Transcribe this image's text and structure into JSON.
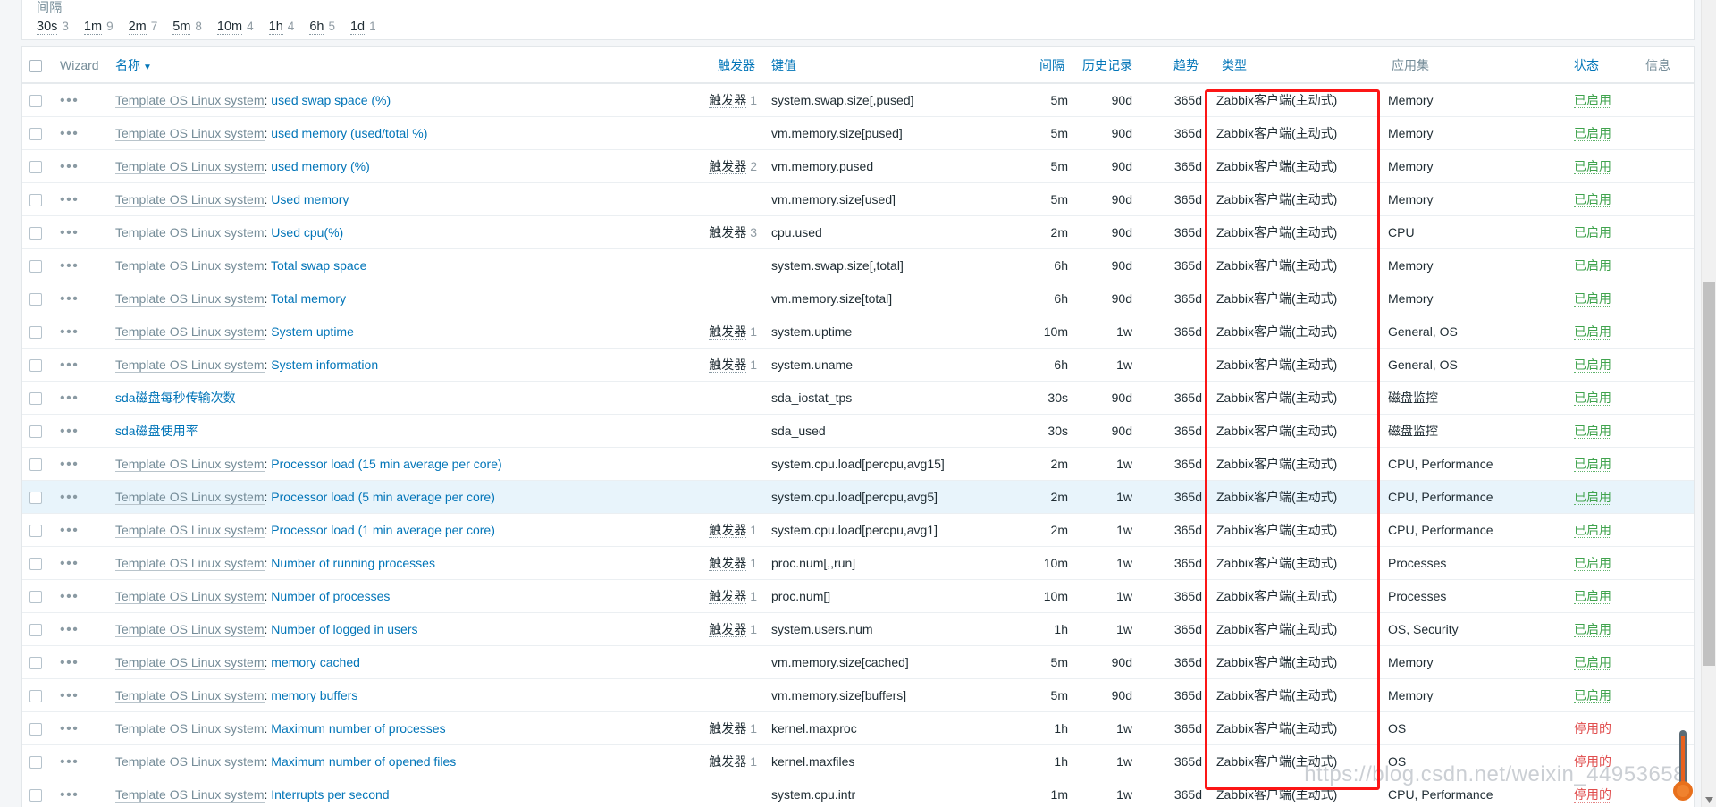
{
  "filter": {
    "label": "间隔",
    "intervals": [
      {
        "value": "30s",
        "count": "3"
      },
      {
        "value": "1m",
        "count": "9"
      },
      {
        "value": "2m",
        "count": "7"
      },
      {
        "value": "5m",
        "count": "8"
      },
      {
        "value": "10m",
        "count": "4"
      },
      {
        "value": "1h",
        "count": "4"
      },
      {
        "value": "6h",
        "count": "5"
      },
      {
        "value": "1d",
        "count": "1"
      }
    ]
  },
  "table": {
    "headers": {
      "wizard": "Wizard",
      "name": "名称",
      "sort_arrow": "▼",
      "triggers": "触发器",
      "key": "键值",
      "interval": "间隔",
      "history": "历史记录",
      "trends": "趋势",
      "type": "类型",
      "applications": "应用集",
      "status": "状态",
      "info": "信息"
    },
    "template_prefix": "Template OS Linux system",
    "triggers_label": "触发器",
    "status_enabled": "已启用",
    "status_disabled": "停用的",
    "type_agent_active": "Zabbix客户端(主动式)",
    "rows": [
      {
        "prefix": "Template OS Linux system",
        "name": "used swap space (%)",
        "triggers": "1",
        "key": "system.swap.size[,pused]",
        "interval": "5m",
        "history": "90d",
        "trends": "365d",
        "type": "Zabbix客户端(主动式)",
        "app": "Memory",
        "status": "已启用",
        "enabled": true,
        "hovered": false
      },
      {
        "prefix": "Template OS Linux system",
        "name": "used memory (used/total %)",
        "triggers": "",
        "key": "vm.memory.size[pused]",
        "interval": "5m",
        "history": "90d",
        "trends": "365d",
        "type": "Zabbix客户端(主动式)",
        "app": "Memory",
        "status": "已启用",
        "enabled": true,
        "hovered": false
      },
      {
        "prefix": "Template OS Linux system",
        "name": "used memory (%)",
        "triggers": "2",
        "key": "vm.memory.pused",
        "interval": "5m",
        "history": "90d",
        "trends": "365d",
        "type": "Zabbix客户端(主动式)",
        "app": "Memory",
        "status": "已启用",
        "enabled": true,
        "hovered": false
      },
      {
        "prefix": "Template OS Linux system",
        "name": "Used memory",
        "triggers": "",
        "key": "vm.memory.size[used]",
        "interval": "5m",
        "history": "90d",
        "trends": "365d",
        "type": "Zabbix客户端(主动式)",
        "app": "Memory",
        "status": "已启用",
        "enabled": true,
        "hovered": false
      },
      {
        "prefix": "Template OS Linux system",
        "name": "Used cpu(%)",
        "triggers": "3",
        "key": "cpu.used",
        "interval": "2m",
        "history": "90d",
        "trends": "365d",
        "type": "Zabbix客户端(主动式)",
        "app": "CPU",
        "status": "已启用",
        "enabled": true,
        "hovered": false
      },
      {
        "prefix": "Template OS Linux system",
        "name": "Total swap space",
        "triggers": "",
        "key": "system.swap.size[,total]",
        "interval": "6h",
        "history": "90d",
        "trends": "365d",
        "type": "Zabbix客户端(主动式)",
        "app": "Memory",
        "status": "已启用",
        "enabled": true,
        "hovered": false
      },
      {
        "prefix": "Template OS Linux system",
        "name": "Total memory",
        "triggers": "",
        "key": "vm.memory.size[total]",
        "interval": "6h",
        "history": "90d",
        "trends": "365d",
        "type": "Zabbix客户端(主动式)",
        "app": "Memory",
        "status": "已启用",
        "enabled": true,
        "hovered": false
      },
      {
        "prefix": "Template OS Linux system",
        "name": "System uptime",
        "triggers": "1",
        "key": "system.uptime",
        "interval": "10m",
        "history": "1w",
        "trends": "365d",
        "type": "Zabbix客户端(主动式)",
        "app": "General, OS",
        "status": "已启用",
        "enabled": true,
        "hovered": false
      },
      {
        "prefix": "Template OS Linux system",
        "name": "System information",
        "triggers": "1",
        "key": "system.uname",
        "interval": "6h",
        "history": "1w",
        "trends": "",
        "type": "Zabbix客户端(主动式)",
        "app": "General, OS",
        "status": "已启用",
        "enabled": true,
        "hovered": false
      },
      {
        "prefix": "",
        "name": "sda磁盘每秒传输次数",
        "triggers": "",
        "key": "sda_iostat_tps",
        "interval": "30s",
        "history": "90d",
        "trends": "365d",
        "type": "Zabbix客户端(主动式)",
        "app": "磁盘监控",
        "status": "已启用",
        "enabled": true,
        "hovered": false
      },
      {
        "prefix": "",
        "name": "sda磁盘使用率",
        "triggers": "",
        "key": "sda_used",
        "interval": "30s",
        "history": "90d",
        "trends": "365d",
        "type": "Zabbix客户端(主动式)",
        "app": "磁盘监控",
        "status": "已启用",
        "enabled": true,
        "hovered": false
      },
      {
        "prefix": "Template OS Linux system",
        "name": "Processor load (15 min average per core)",
        "triggers": "",
        "key": "system.cpu.load[percpu,avg15]",
        "interval": "2m",
        "history": "1w",
        "trends": "365d",
        "type": "Zabbix客户端(主动式)",
        "app": "CPU, Performance",
        "status": "已启用",
        "enabled": true,
        "hovered": false
      },
      {
        "prefix": "Template OS Linux system",
        "name": "Processor load (5 min average per core)",
        "triggers": "",
        "key": "system.cpu.load[percpu,avg5]",
        "interval": "2m",
        "history": "1w",
        "trends": "365d",
        "type": "Zabbix客户端(主动式)",
        "app": "CPU, Performance",
        "status": "已启用",
        "enabled": true,
        "hovered": true
      },
      {
        "prefix": "Template OS Linux system",
        "name": "Processor load (1 min average per core)",
        "triggers": "1",
        "key": "system.cpu.load[percpu,avg1]",
        "interval": "2m",
        "history": "1w",
        "trends": "365d",
        "type": "Zabbix客户端(主动式)",
        "app": "CPU, Performance",
        "status": "已启用",
        "enabled": true,
        "hovered": false
      },
      {
        "prefix": "Template OS Linux system",
        "name": "Number of running processes",
        "triggers": "1",
        "key": "proc.num[,,run]",
        "interval": "10m",
        "history": "1w",
        "trends": "365d",
        "type": "Zabbix客户端(主动式)",
        "app": "Processes",
        "status": "已启用",
        "enabled": true,
        "hovered": false
      },
      {
        "prefix": "Template OS Linux system",
        "name": "Number of processes",
        "triggers": "1",
        "key": "proc.num[]",
        "interval": "10m",
        "history": "1w",
        "trends": "365d",
        "type": "Zabbix客户端(主动式)",
        "app": "Processes",
        "status": "已启用",
        "enabled": true,
        "hovered": false
      },
      {
        "prefix": "Template OS Linux system",
        "name": "Number of logged in users",
        "triggers": "1",
        "key": "system.users.num",
        "interval": "1h",
        "history": "1w",
        "trends": "365d",
        "type": "Zabbix客户端(主动式)",
        "app": "OS, Security",
        "status": "已启用",
        "enabled": true,
        "hovered": false
      },
      {
        "prefix": "Template OS Linux system",
        "name": "memory cached",
        "triggers": "",
        "key": "vm.memory.size[cached]",
        "interval": "5m",
        "history": "90d",
        "trends": "365d",
        "type": "Zabbix客户端(主动式)",
        "app": "Memory",
        "status": "已启用",
        "enabled": true,
        "hovered": false
      },
      {
        "prefix": "Template OS Linux system",
        "name": "memory buffers",
        "triggers": "",
        "key": "vm.memory.size[buffers]",
        "interval": "5m",
        "history": "90d",
        "trends": "365d",
        "type": "Zabbix客户端(主动式)",
        "app": "Memory",
        "status": "已启用",
        "enabled": true,
        "hovered": false
      },
      {
        "prefix": "Template OS Linux system",
        "name": "Maximum number of processes",
        "triggers": "1",
        "key": "kernel.maxproc",
        "interval": "1h",
        "history": "1w",
        "trends": "365d",
        "type": "Zabbix客户端(主动式)",
        "app": "OS",
        "status": "停用的",
        "enabled": false,
        "hovered": false
      },
      {
        "prefix": "Template OS Linux system",
        "name": "Maximum number of opened files",
        "triggers": "1",
        "key": "kernel.maxfiles",
        "interval": "1h",
        "history": "1w",
        "trends": "365d",
        "type": "Zabbix客户端(主动式)",
        "app": "OS",
        "status": "停用的",
        "enabled": false,
        "hovered": false
      },
      {
        "prefix": "Template OS Linux system",
        "name": "Interrupts per second",
        "triggers": "",
        "key": "system.cpu.intr",
        "interval": "1m",
        "history": "1w",
        "trends": "365d",
        "type": "Zabbix客户端(主动式)",
        "app": "CPU, Performance",
        "status": "停用的",
        "enabled": false,
        "hovered": false
      }
    ]
  },
  "watermark": {
    "text": "https://blog.csdn.net/weixin_44953658"
  },
  "colors": {
    "link": "#0275b8",
    "muted": "#768d99",
    "enabled": "#3fa34d",
    "disabled": "#e04d4d",
    "annotation": "#fc1616",
    "row_hover": "#e8f4fb"
  }
}
